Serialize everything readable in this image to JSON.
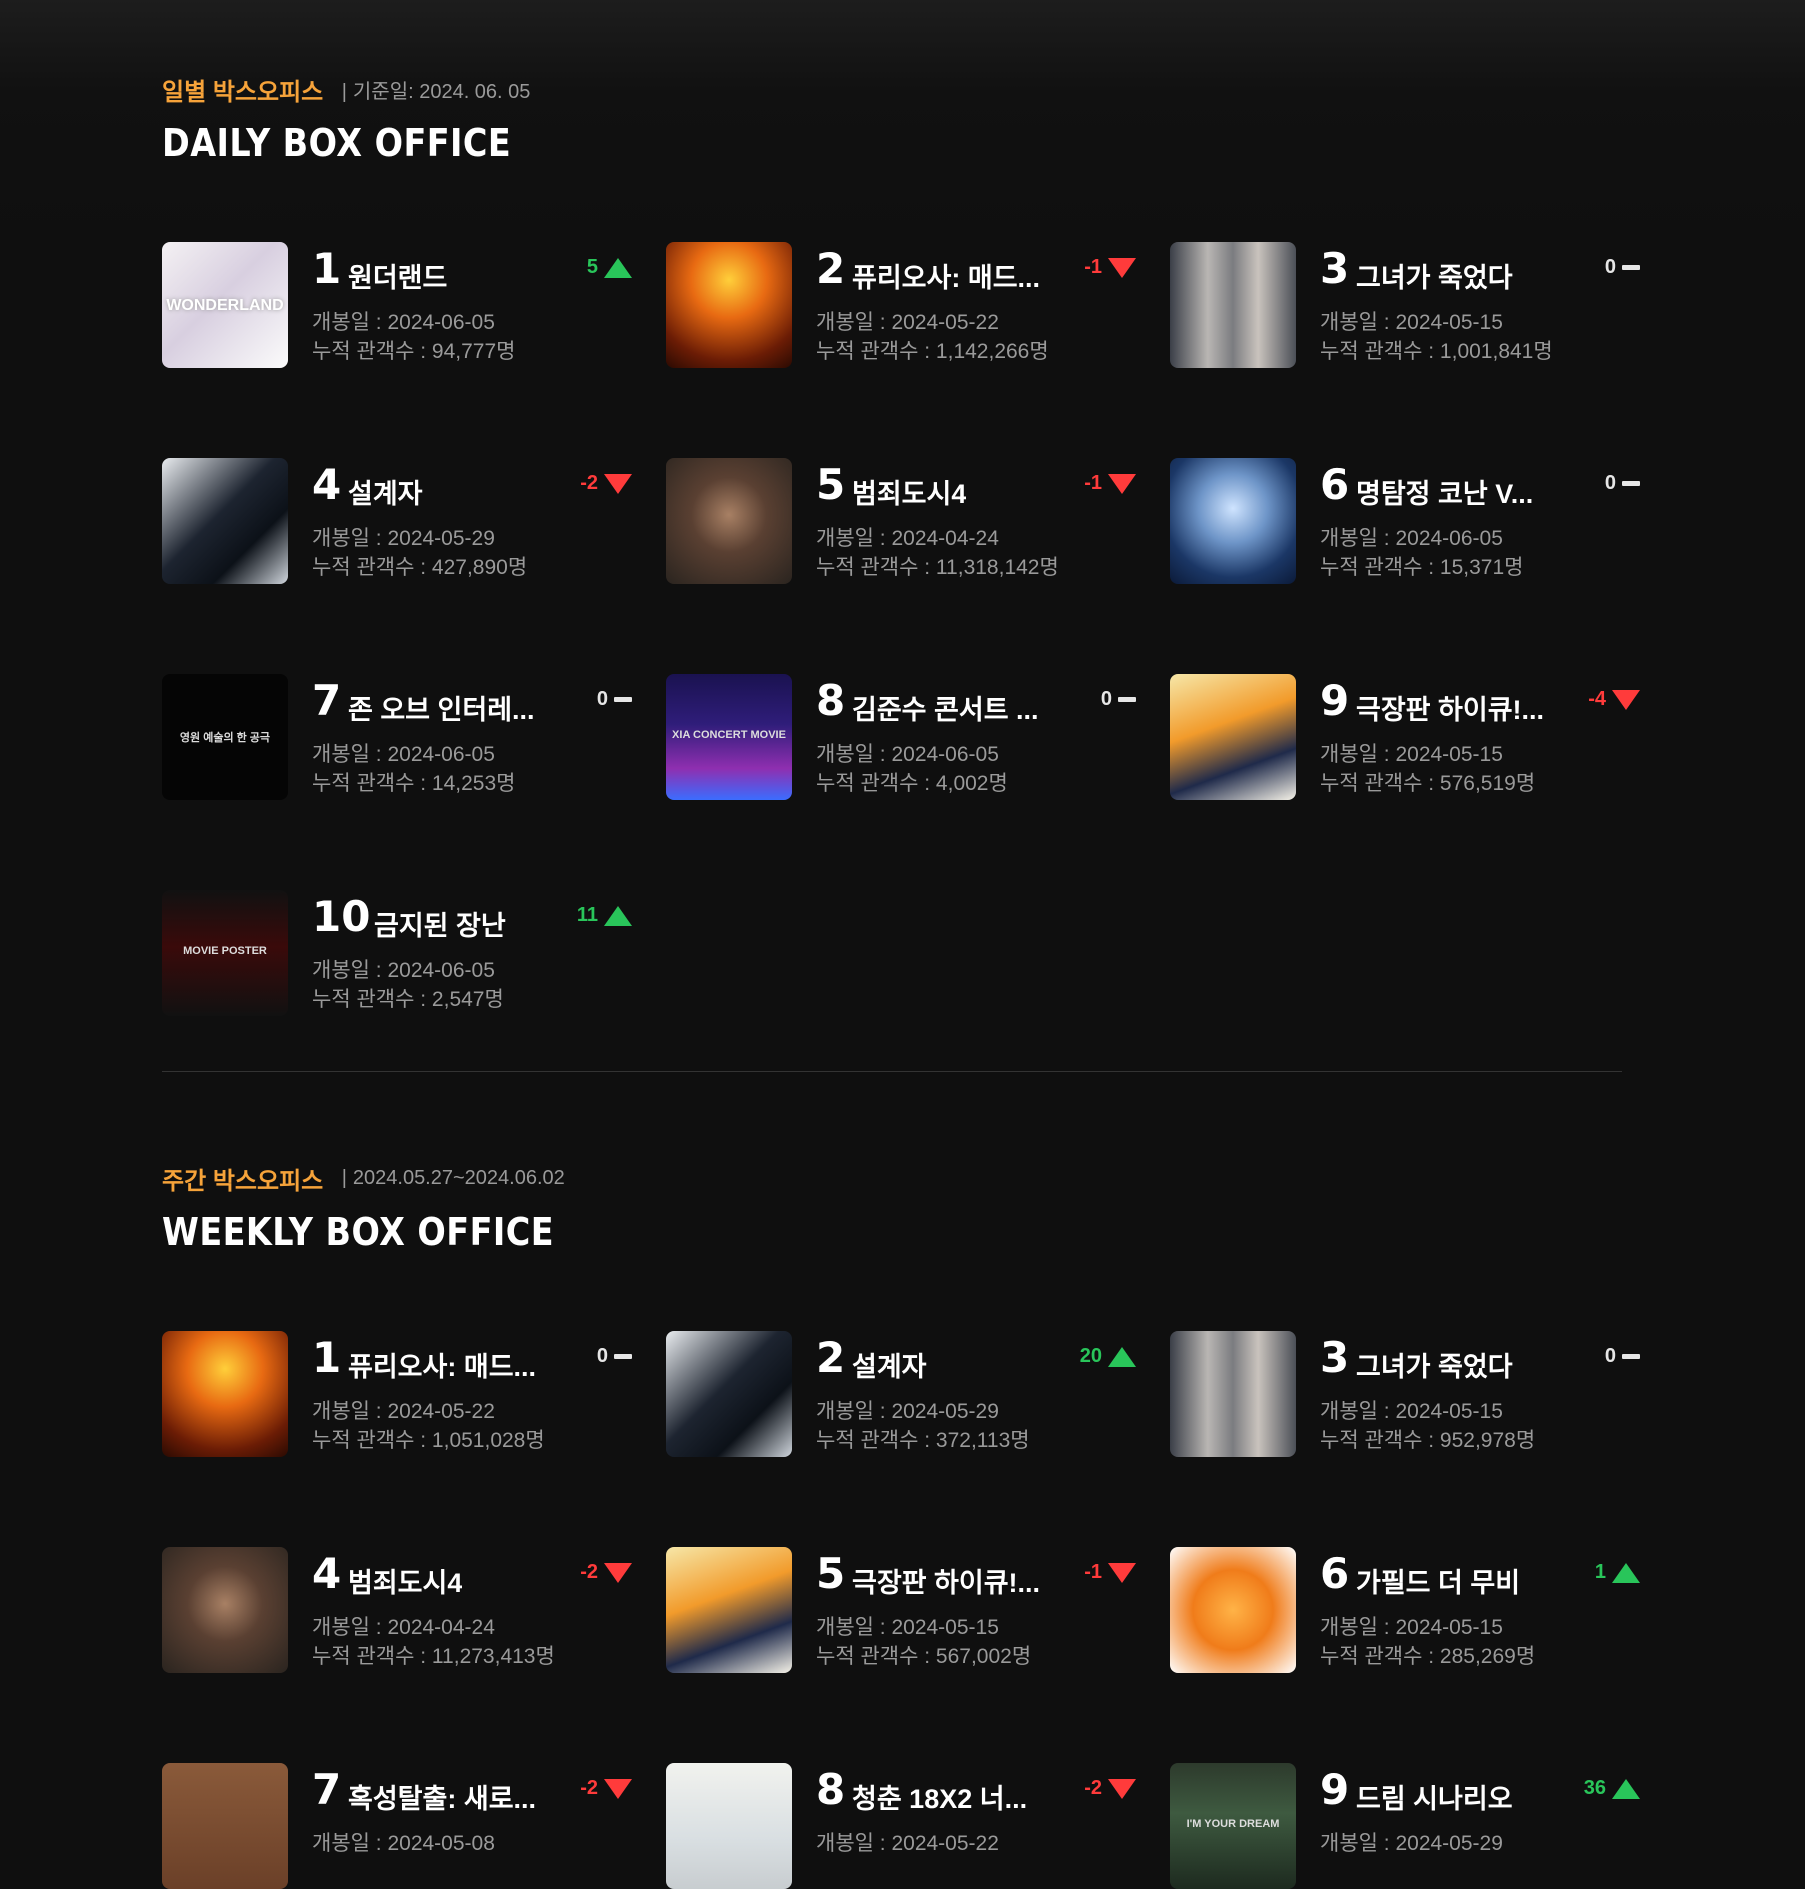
{
  "daily": {
    "subtitle": "일별 박스오피스",
    "date": "기준일: 2024. 06. 05",
    "title": "DAILY BOX OFFICE",
    "items": [
      {
        "rank": "1",
        "name": "원더랜드",
        "change": "5",
        "dir": "up",
        "open": "개봉일 : 2024-06-05",
        "aud": "누적 관객수 : 94,777명",
        "poster": "p-wonderland"
      },
      {
        "rank": "2",
        "name": "퓨리오사: 매드...",
        "change": "-1",
        "dir": "down",
        "open": "개봉일 : 2024-05-22",
        "aud": "누적 관객수 : 1,142,266명",
        "poster": "p-furiosa"
      },
      {
        "rank": "3",
        "name": "그녀가 죽었다",
        "change": "0",
        "dir": "same",
        "open": "개봉일 : 2024-05-15",
        "aud": "누적 관객수 : 1,001,841명",
        "poster": "p-shesdead"
      },
      {
        "rank": "4",
        "name": "설계자",
        "change": "-2",
        "dir": "down",
        "open": "개봉일 : 2024-05-29",
        "aud": "누적 관객수 : 427,890명",
        "poster": "p-designer"
      },
      {
        "rank": "5",
        "name": "범죄도시4",
        "change": "-1",
        "dir": "down",
        "open": "개봉일 : 2024-04-24",
        "aud": "누적 관객수 : 11,318,142명",
        "poster": "p-roundup"
      },
      {
        "rank": "6",
        "name": "명탐정 코난 V...",
        "change": "0",
        "dir": "same",
        "open": "개봉일 : 2024-06-05",
        "aud": "누적 관객수 : 15,371명",
        "poster": "p-conan"
      },
      {
        "rank": "7",
        "name": "존 오브 인터레...",
        "change": "0",
        "dir": "same",
        "open": "개봉일 : 2024-06-05",
        "aud": "누적 관객수 : 14,253명",
        "poster": "p-zone"
      },
      {
        "rank": "8",
        "name": "김준수 콘서트 ...",
        "change": "0",
        "dir": "same",
        "open": "개봉일 : 2024-06-05",
        "aud": "누적 관객수 : 4,002명",
        "poster": "p-concert"
      },
      {
        "rank": "9",
        "name": "극장판 하이큐!...",
        "change": "-4",
        "dir": "down",
        "open": "개봉일 : 2024-05-15",
        "aud": "누적 관객수 : 576,519명",
        "poster": "p-haikyu"
      },
      {
        "rank": "10",
        "name": "금지된 장난",
        "change": "11",
        "dir": "up",
        "open": "개봉일 : 2024-06-05",
        "aud": "누적 관객수 : 2,547명",
        "poster": "p-forbidden"
      }
    ]
  },
  "weekly": {
    "subtitle": "주간 박스오피스",
    "date": "2024.05.27~2024.06.02",
    "title": "WEEKLY BOX OFFICE",
    "items": [
      {
        "rank": "1",
        "name": "퓨리오사: 매드...",
        "change": "0",
        "dir": "same",
        "open": "개봉일 : 2024-05-22",
        "aud": "누적 관객수 : 1,051,028명",
        "poster": "p-furiosa"
      },
      {
        "rank": "2",
        "name": "설계자",
        "change": "20",
        "dir": "up",
        "open": "개봉일 : 2024-05-29",
        "aud": "누적 관객수 : 372,113명",
        "poster": "p-designer"
      },
      {
        "rank": "3",
        "name": "그녀가 죽었다",
        "change": "0",
        "dir": "same",
        "open": "개봉일 : 2024-05-15",
        "aud": "누적 관객수 : 952,978명",
        "poster": "p-shesdead"
      },
      {
        "rank": "4",
        "name": "범죄도시4",
        "change": "-2",
        "dir": "down",
        "open": "개봉일 : 2024-04-24",
        "aud": "누적 관객수 : 11,273,413명",
        "poster": "p-roundup"
      },
      {
        "rank": "5",
        "name": "극장판 하이큐!...",
        "change": "-1",
        "dir": "down",
        "open": "개봉일 : 2024-05-15",
        "aud": "누적 관객수 : 567,002명",
        "poster": "p-haikyu"
      },
      {
        "rank": "6",
        "name": "가필드 더 무비",
        "change": "1",
        "dir": "up",
        "open": "개봉일 : 2024-05-15",
        "aud": "누적 관객수 : 285,269명",
        "poster": "p-garfield"
      },
      {
        "rank": "7",
        "name": "혹성탈출: 새로...",
        "change": "-2",
        "dir": "down",
        "open": "개봉일 : 2024-05-08",
        "aud": "",
        "poster": "p-apes"
      },
      {
        "rank": "8",
        "name": "청춘 18X2 너...",
        "change": "-2",
        "dir": "down",
        "open": "개봉일 : 2024-05-22",
        "aud": "",
        "poster": "p-youth"
      },
      {
        "rank": "9",
        "name": "드림 시나리오",
        "change": "36",
        "dir": "up",
        "open": "개봉일 : 2024-05-29",
        "aud": "",
        "poster": "p-dream"
      }
    ]
  },
  "posters": {
    "p-wonderland": {
      "bg": "linear-gradient(135deg,#f4f1f3 0%,#d8cfe0 45%,#fbfbfb 100%)",
      "text": "WONDERLAND"
    },
    "p-furiosa": {
      "bg": "radial-gradient(circle at 50% 30%,#ffcf3a 0%,#e86a12 35%,#6b1c05 75%,#2a0a02 100%)",
      "text": ""
    },
    "p-shesdead": {
      "bg": "linear-gradient(90deg,#3b3f48 0%,#b9b6b3 30%,#7b7c80 50%,#c9c3bd 70%,#4b4f57 100%)",
      "text": ""
    },
    "p-designer": {
      "bg": "linear-gradient(135deg,#e9ecef 0%,#1d2430 45%,#0c1118 70%,#cfd5dc 100%)",
      "text": ""
    },
    "p-roundup": {
      "bg": "radial-gradient(circle at 50% 45%,#a88064 0%,#5a4032 40%,#2a241f 100%)",
      "text": ""
    },
    "p-conan": {
      "bg": "radial-gradient(circle at 50% 40%,#cfe4ff 0%,#6e95c8 35%,#1b3766 70%,#0b1a38 100%)",
      "text": ""
    },
    "p-zone": {
      "bg": "#050505",
      "text": "영원 예술의 한 공극"
    },
    "p-concert": {
      "bg": "linear-gradient(180deg,#1a1250 0%,#2f1d7a 40%,#8f2fb0 75%,#3b6dff 100%)",
      "text": "XIA CONCERT MOVIE"
    },
    "p-haikyu": {
      "bg": "linear-gradient(160deg,#f6e7a8 0%,#f29b2b 40%,#1f2a4a 70%,#f5f2e8 100%)",
      "text": ""
    },
    "p-forbidden": {
      "bg": "linear-gradient(180deg,#111 0%,#3a0a0a 45%,#111 100%)",
      "text": "MOVIE POSTER"
    },
    "p-garfield": {
      "bg": "radial-gradient(circle at 50% 50%,#ffb347 0%,#f07c1a 45%,#fff 100%)",
      "text": ""
    },
    "p-apes": {
      "bg": "linear-gradient(180deg,#8a5a3a 0%,#6b4028 100%)",
      "text": ""
    },
    "p-youth": {
      "bg": "linear-gradient(180deg,#f1f2ee 0%,#d9dfe2 60%,#c8cdd0 100%)",
      "text": ""
    },
    "p-dream": {
      "bg": "linear-gradient(180deg,#2d3a2c 0%,#3e5a40 40%,#1d2a1f 100%)",
      "text": "I'M YOUR DREAM"
    }
  }
}
